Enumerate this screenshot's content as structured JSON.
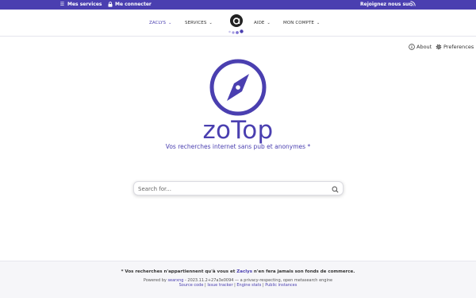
{
  "topbar": {
    "services": "Mes services",
    "login": "Me connecter",
    "join": "Rejoignez nous sur"
  },
  "nav": {
    "zaclys": "ZACLYS",
    "services": "SERVICES",
    "aide": "AIDE",
    "account": "MON COMPTE"
  },
  "links": {
    "about": "About",
    "preferences": "Preferences"
  },
  "brand": {
    "name": "zoTop",
    "tagline": "Vos recherches internet sans pub et anonymes *"
  },
  "search": {
    "placeholder": "Search for..."
  },
  "footer": {
    "note_part1": "* Vos recherches n'appartiennent qu'à vous et ",
    "note_link": "Zaclys",
    "note_part2": " n'en fera jamais son fonds de commerce.",
    "powered_prefix": "Powered by ",
    "powered_link": "searxng",
    "powered_suffix": " - 2023.11.2+27a3e0094 — a privacy-respecting, open metasearch engine",
    "source_code": "Source code",
    "issue_tracker": "Issue tracker",
    "engine_stats": "Engine stats",
    "public_instances": "Public instances",
    "separator": "|"
  },
  "colors": {
    "accent": "#4a3fb0",
    "logo_dark": "#222222"
  }
}
